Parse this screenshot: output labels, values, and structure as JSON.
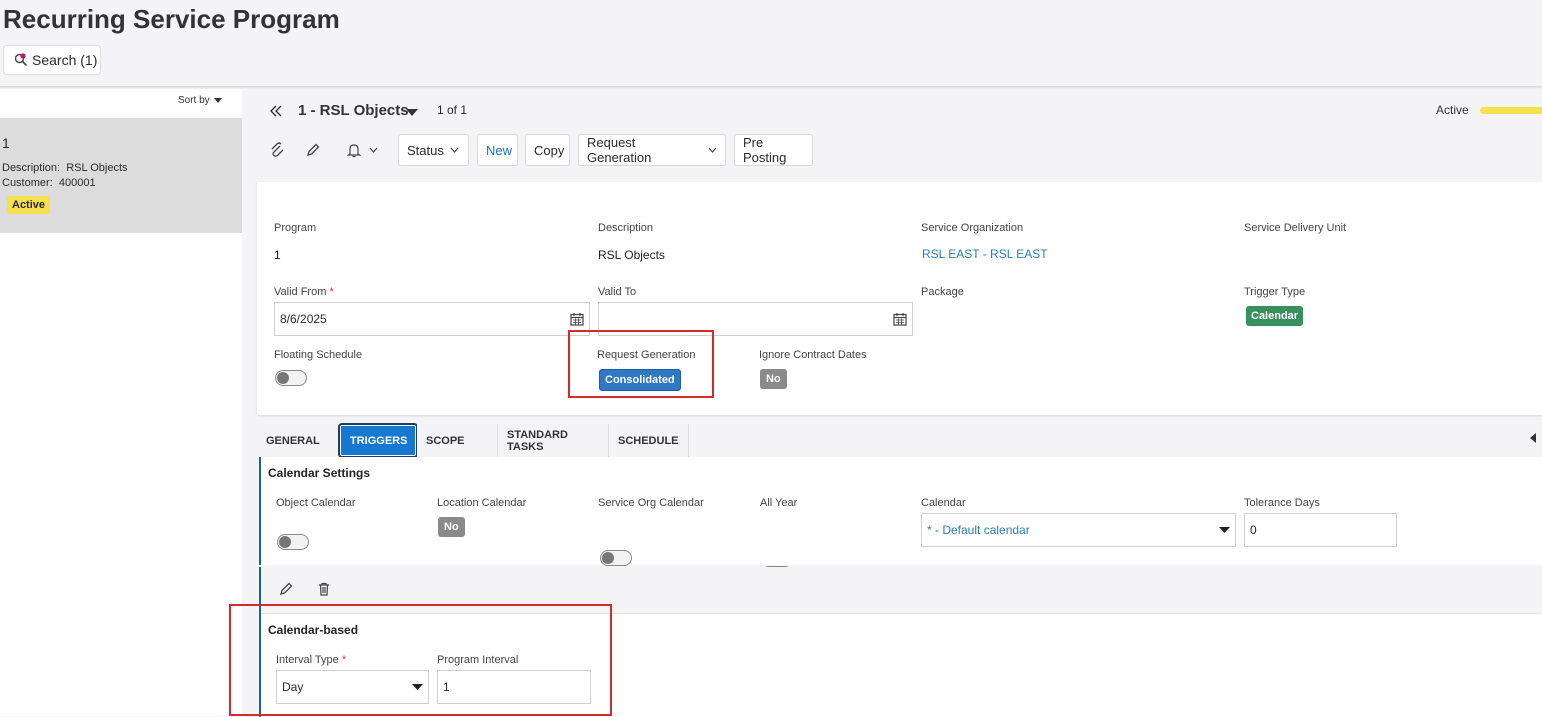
{
  "page": {
    "title": "Recurring Service Program"
  },
  "search": {
    "label": "Search (1)"
  },
  "list": {
    "sort_label": "Sort by",
    "item": {
      "number": "1",
      "description_label": "Description:",
      "description": "RSL Objects",
      "customer_label": "Customer:",
      "customer": "400001",
      "status": "Active"
    }
  },
  "record": {
    "title": "1 - RSL Objects",
    "count": "1 of 1",
    "status": "Active",
    "status_color": "#f5e04e"
  },
  "toolbar": {
    "status_label": "Status",
    "new_label": "New",
    "copy_label": "Copy",
    "request_generation_label": "Request Generation",
    "pre_posting_label": "Pre Posting"
  },
  "header": {
    "program_label": "Program",
    "program": "1",
    "description_label": "Description",
    "description": "RSL Objects",
    "service_org_label": "Service Organization",
    "service_org": "RSL EAST - RSL EAST",
    "service_delivery_unit_label": "Service Delivery Unit",
    "valid_from_label": "Valid From",
    "valid_from": "8/6/2025",
    "valid_to_label": "Valid To",
    "valid_to": "",
    "package_label": "Package",
    "trigger_type_label": "Trigger Type",
    "trigger_type": "Calendar",
    "floating_schedule_label": "Floating Schedule",
    "request_generation_label": "Request Generation",
    "request_generation": "Consolidated",
    "ignore_contract_dates_label": "Ignore Contract Dates",
    "ignore_contract_dates": "No",
    "required_mark": "*"
  },
  "tabs": [
    {
      "label": "GENERAL"
    },
    {
      "label": "TRIGGERS"
    },
    {
      "label": "SCOPE"
    },
    {
      "label": "STANDARD TASKS"
    },
    {
      "label": "SCHEDULE"
    }
  ],
  "calendar_settings": {
    "title": "Calendar Settings",
    "object_calendar_label": "Object Calendar",
    "location_calendar_label": "Location Calendar",
    "location_calendar": "No",
    "service_org_calendar_label": "Service Org Calendar",
    "all_year_label": "All Year",
    "calendar_label": "Calendar",
    "calendar": "* - Default calendar",
    "tolerance_days_label": "Tolerance Days",
    "tolerance_days": "0"
  },
  "calendar_based": {
    "title": "Calendar-based",
    "interval_type_label": "Interval Type",
    "interval_type": "Day",
    "program_interval_label": "Program Interval",
    "program_interval": "1"
  },
  "colors": {
    "accent": "#1678d1",
    "highlight_box": "#d42a2a",
    "trigger_badge": "#3a8f5e",
    "request_badge": "#2f78c4"
  }
}
